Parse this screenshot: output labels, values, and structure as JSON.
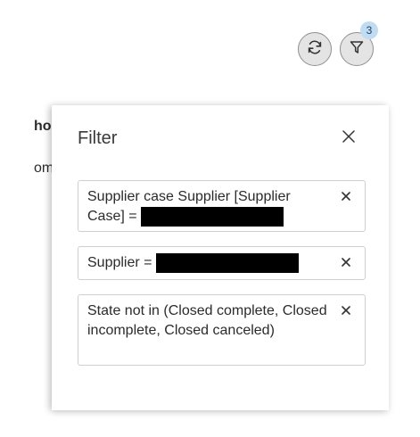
{
  "toolbar": {
    "refresh_icon": "refresh-icon",
    "filter_icon": "funnel-icon",
    "filter_badge": "3"
  },
  "background": {
    "text_1": "ho",
    "text_2": "om"
  },
  "filter_panel": {
    "title": "Filter",
    "close_icon": "close-icon",
    "conditions": [
      {
        "prefix": "Supplier case Supplier [Supplier Case] =",
        "redacted": true
      },
      {
        "prefix": "Supplier =",
        "redacted": true
      },
      {
        "prefix": "State not in (Closed complete, Closed incomplete, Closed canceled)",
        "redacted": false
      }
    ]
  },
  "colors": {
    "button_bg": "#e4e4e4",
    "badge_bg": "#bfdcf3",
    "chip_border": "#cfcfcf"
  }
}
